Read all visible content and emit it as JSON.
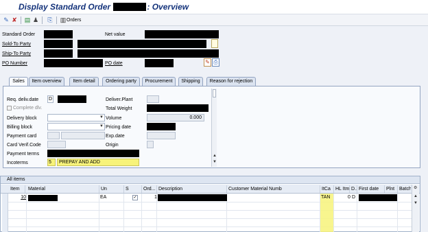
{
  "window": {
    "title_prefix": "Display Standard Order",
    "title_suffix": ": Overview"
  },
  "toolbar": {
    "orders_label": "Orders"
  },
  "header": {
    "standard_order_label": "Standard Order",
    "net_value_label": "Net value",
    "sold_to_label": "Sold-To Party",
    "ship_to_label": "Ship-To Party",
    "po_number_label": "PO Number",
    "po_date_label": "PO date"
  },
  "tabs": [
    {
      "label": "Sales"
    },
    {
      "label": "Item overview"
    },
    {
      "label": "Item detail"
    },
    {
      "label": "Ordering party"
    },
    {
      "label": "Procurement"
    },
    {
      "label": "Shipping"
    },
    {
      "label": "Reason for rejection"
    }
  ],
  "sales": {
    "req_deliv_date_label": "Req. deliv.date",
    "req_deliv_date_format": "D",
    "complete_div_label": "Complete dlv.",
    "delivery_block_label": "Delivery block",
    "billing_block_label": "Billing block",
    "payment_card_label": "Payment card",
    "card_verif_label": "Card Verif.Code",
    "payment_terms_label": "Payment terms",
    "incoterms_label": "Incoterms",
    "incoterms_code": "5",
    "incoterms_desc": "PREPAY AND ADD",
    "deliver_plant_label": "Deliver.Plant",
    "total_weight_label": "Total Weight",
    "volume_label": "Volume",
    "volume_value": "0.000",
    "pricing_date_label": "Pricing date",
    "exp_date_label": "Exp.date",
    "origin_label": "Origin"
  },
  "items": {
    "title": "All items",
    "columns": [
      "Item",
      "Material",
      "Un",
      "S",
      "Ord...",
      "Description",
      "Customer Material Numb",
      "ItCa",
      "HL Itm",
      "D..",
      "First date",
      "Plnt",
      "Batch"
    ],
    "rows": [
      {
        "item": "10",
        "un": "EA",
        "ord": "1",
        "itca": "TAN",
        "hl_itm": "0",
        "d": "D"
      }
    ]
  }
}
